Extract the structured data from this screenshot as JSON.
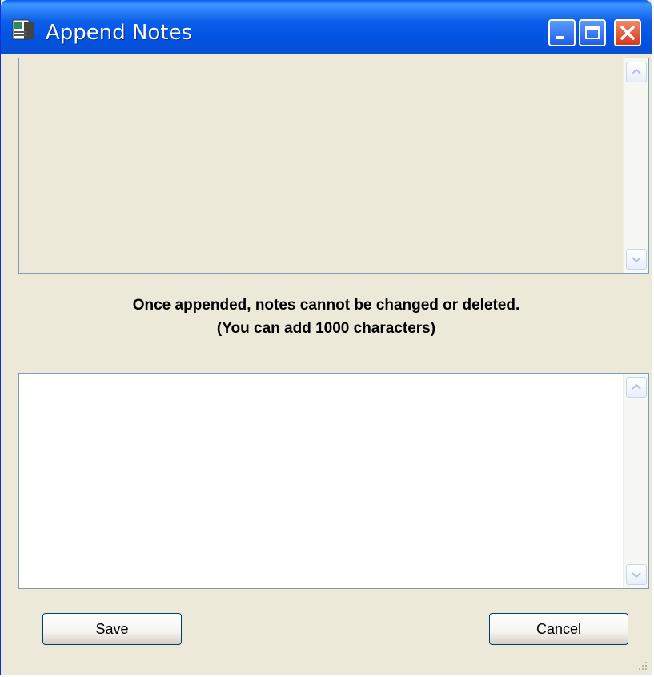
{
  "window": {
    "title": "Append Notes",
    "icons": {
      "app": "notes-app-icon",
      "minimize": "minimize-icon",
      "maximize": "maximize-icon",
      "close": "close-icon"
    },
    "colors": {
      "titlebar": "#0054e3",
      "body": "#ece9d8",
      "close_button": "#d6391c"
    }
  },
  "existing_notes": {
    "value": ""
  },
  "notice": {
    "line1": "Once appended, notes cannot be changed or deleted.",
    "line2": "(You can add 1000 characters)"
  },
  "new_note": {
    "value": ""
  },
  "buttons": {
    "save": "Save",
    "cancel": "Cancel"
  }
}
